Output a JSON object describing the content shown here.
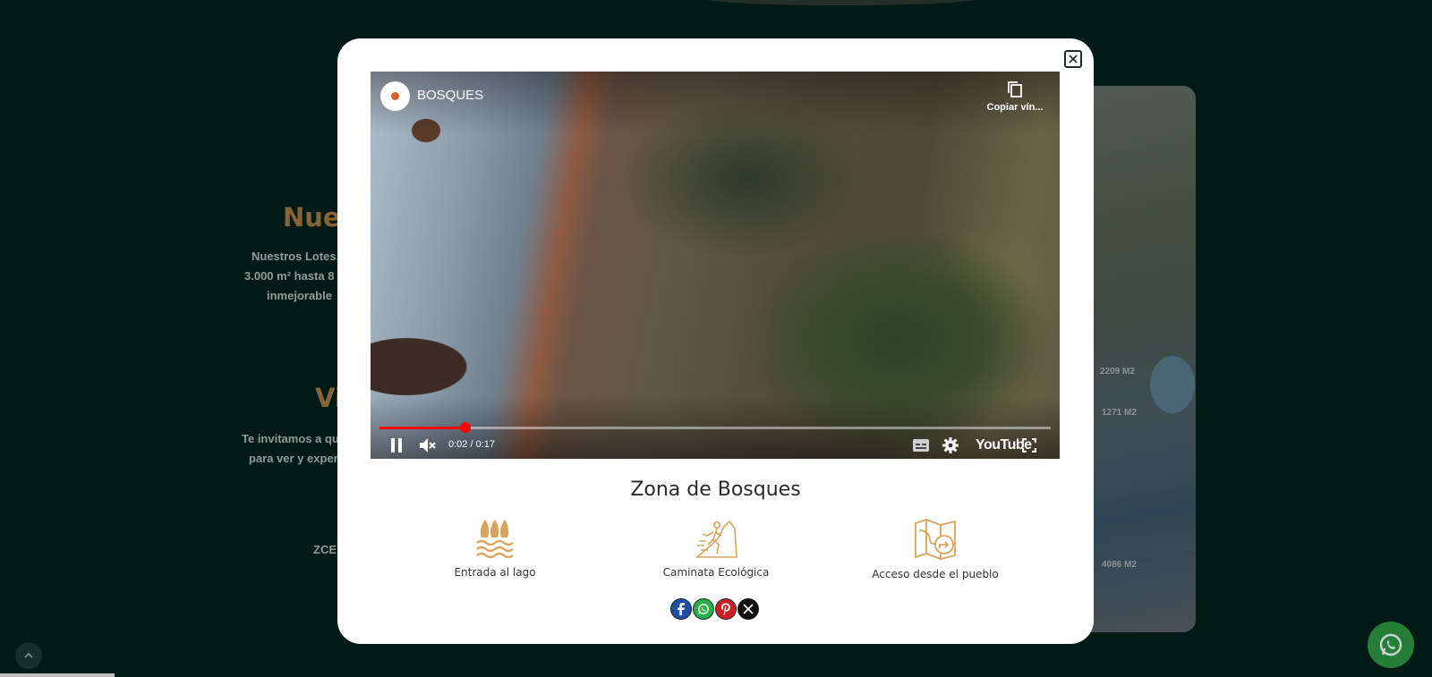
{
  "background": {
    "heading_fragment": "Nues",
    "para_lines": [
      "Nuestros Lotes,",
      "3.000 m² hasta 8",
      "inmejorable"
    ],
    "heading2_fragment": "Vi",
    "para2_lines": [
      "Te invitamos a qu",
      "para ver y experi"
    ],
    "code_fragment": "ZCE",
    "map_labels": [
      "2209 M2",
      "1271 M2",
      "4086 M2"
    ]
  },
  "modal": {
    "video": {
      "channel_name": "BOSQUES",
      "copy_link_label": "Copiar vín...",
      "current_time": "0:02",
      "duration": "0:17",
      "time_display": "0:02 / 0:17",
      "progress_fraction": 0.128,
      "brand_label": "YouTube"
    },
    "title": "Zona de Bosques",
    "features": [
      {
        "icon": "lake-entrance-icon",
        "label": "Entrada al lago"
      },
      {
        "icon": "hiking-icon",
        "label": "Caminata Ecológica"
      },
      {
        "icon": "map-route-icon",
        "label": "Acceso desde el pueblo"
      }
    ],
    "share": [
      {
        "icon": "facebook-icon",
        "color": "#1f4fa5"
      },
      {
        "icon": "whatsapp-icon",
        "color": "#25b04a"
      },
      {
        "icon": "pinterest-icon",
        "color": "#c8202a"
      },
      {
        "icon": "x-icon",
        "color": "#111111"
      }
    ]
  },
  "colors": {
    "page_bg": "#03201b",
    "accent_gold": "#a57a45",
    "icon_gold": "#d9a55d",
    "whatsapp_float": "#2d9a45"
  }
}
